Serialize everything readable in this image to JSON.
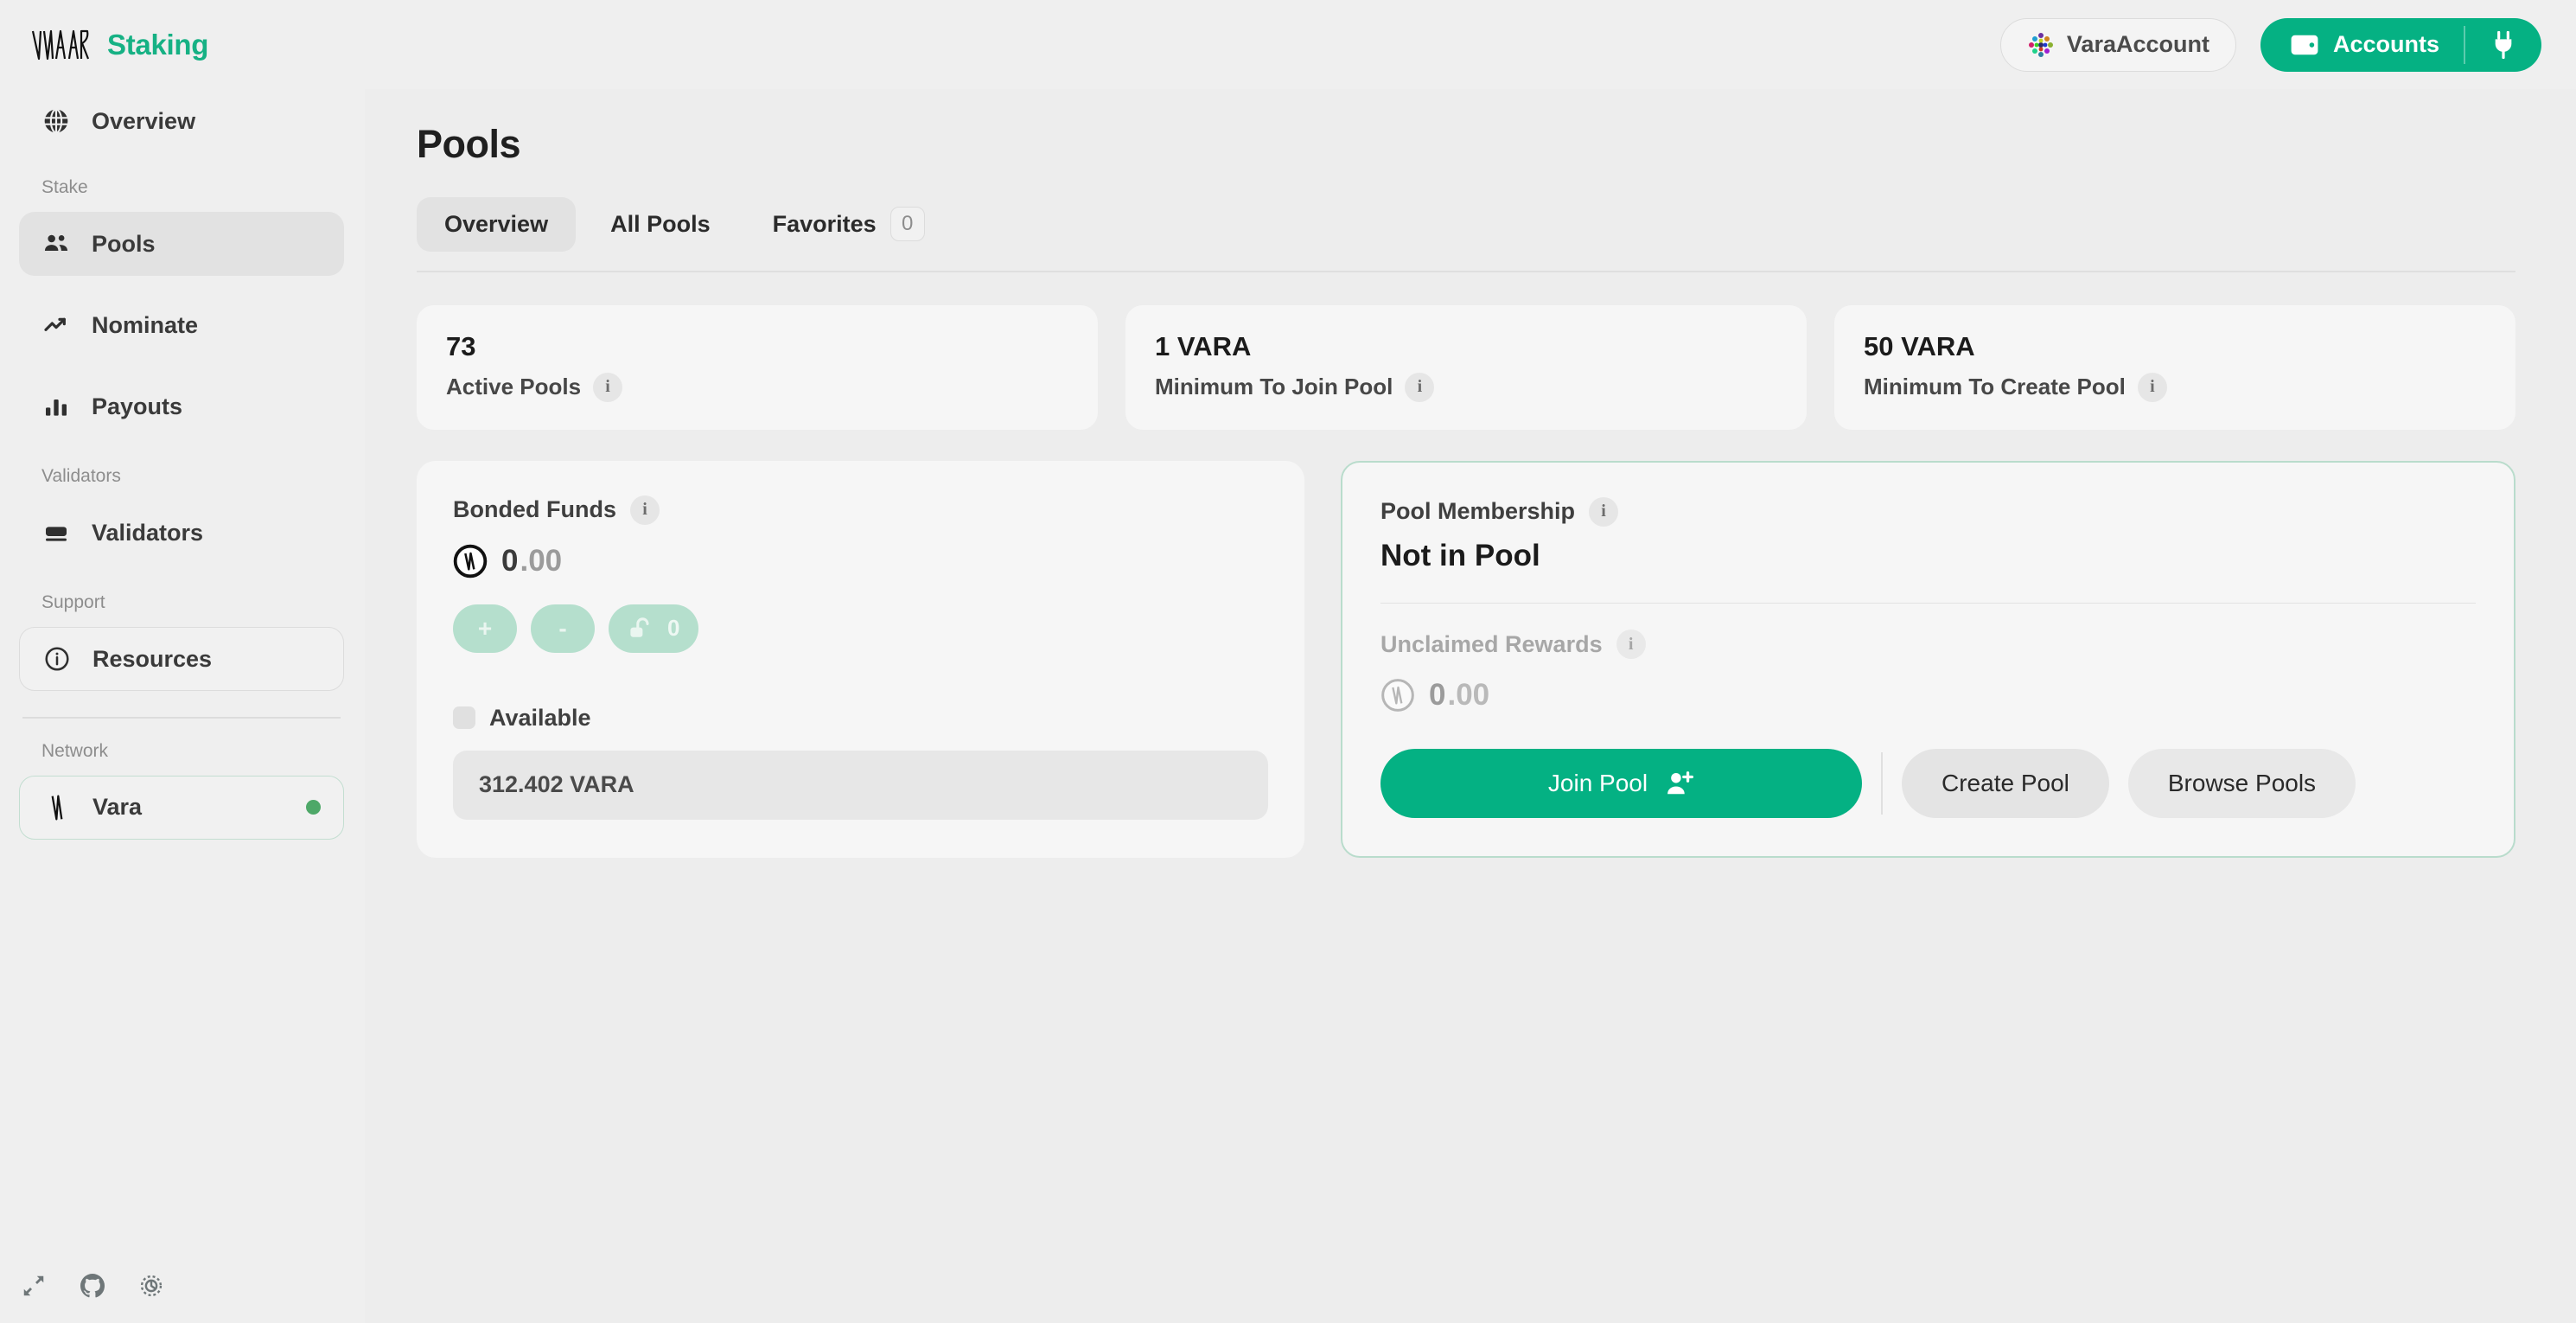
{
  "header": {
    "brand_logo_alt": "vara-logo",
    "brand_title": "Staking",
    "account_name": "VaraAccount",
    "accounts_label": "Accounts"
  },
  "sidebar": {
    "overview": {
      "label": "Overview",
      "icon": "globe-icon"
    },
    "groups": [
      {
        "label": "Stake",
        "items": [
          {
            "label": "Pools",
            "icon": "users-icon",
            "active": true
          },
          {
            "label": "Nominate",
            "icon": "trending-up-icon",
            "active": false
          },
          {
            "label": "Payouts",
            "icon": "bar-chart-icon",
            "active": false
          }
        ]
      },
      {
        "label": "Validators",
        "items": [
          {
            "label": "Validators",
            "icon": "server-icon",
            "active": false
          }
        ]
      },
      {
        "label": "Support",
        "items": [
          {
            "label": "Resources",
            "icon": "info-circle-icon",
            "active": false
          }
        ]
      },
      {
        "label": "Network",
        "items": [
          {
            "label": "Vara",
            "icon": "vara-mark-icon",
            "active": false
          }
        ]
      }
    ],
    "footer_icons": [
      "collapse-icon",
      "github-icon",
      "gear-icon"
    ]
  },
  "main": {
    "page_title": "Pools",
    "tabs": [
      {
        "label": "Overview",
        "active": true
      },
      {
        "label": "All Pools",
        "active": false
      },
      {
        "label": "Favorites",
        "active": false,
        "badge": "0"
      }
    ],
    "stats": [
      {
        "value": "73",
        "label": "Active Pools"
      },
      {
        "value": "1 VARA",
        "label": "Minimum To Join Pool"
      },
      {
        "value": "50 VARA",
        "label": "Minimum To Create Pool"
      }
    ],
    "bonded_card": {
      "title": "Bonded Funds",
      "amount_int": "0",
      "amount_dec": ".00",
      "pill_add": "+",
      "pill_sub": "-",
      "pill_unlock_count": "0",
      "available_label": "Available",
      "available_value": "312.402 VARA"
    },
    "pool_card": {
      "title": "Pool Membership",
      "status": "Not in Pool",
      "rewards_label": "Unclaimed Rewards",
      "rewards_int": "0",
      "rewards_dec": ".00",
      "join_label": "Join Pool",
      "create_label": "Create Pool",
      "browse_label": "Browse Pools"
    }
  },
  "colors": {
    "accent": "#04b183",
    "accent_soft": "#b5dfcd",
    "border_green": "#b9dccc",
    "page_bg": "#ededed",
    "card_bg": "#f6f6f6",
    "status_dot": "#4ea868"
  }
}
